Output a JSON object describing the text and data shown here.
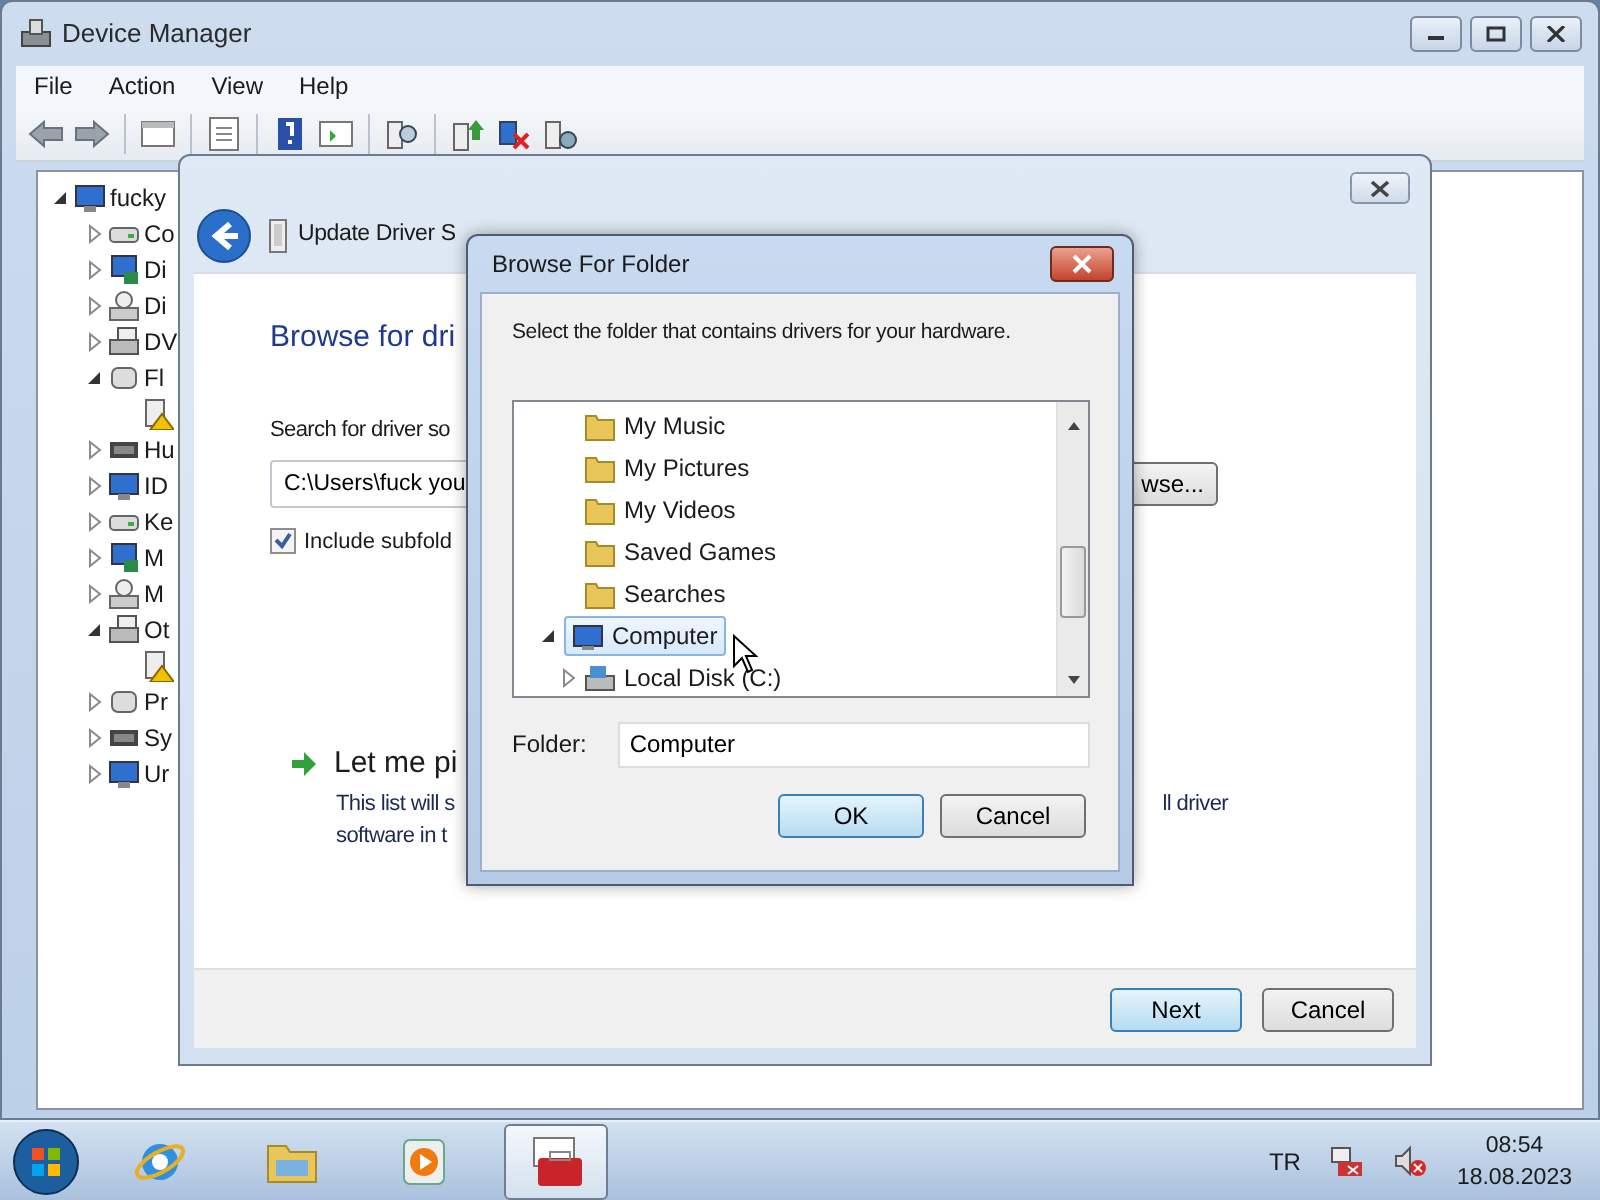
{
  "device_manager": {
    "title": "Device Manager",
    "menu": [
      "File",
      "Action",
      "View",
      "Help"
    ],
    "tree": [
      {
        "label": "fucky",
        "kind": "category",
        "expanded": true,
        "children": [
          {
            "label": "Co",
            "kind": "category",
            "expanded": false
          },
          {
            "label": "Di",
            "kind": "category",
            "expanded": false
          },
          {
            "label": "Di",
            "kind": "category",
            "expanded": false
          },
          {
            "label": "DV",
            "kind": "category",
            "expanded": false
          },
          {
            "label": "Fl",
            "kind": "category",
            "expanded": true,
            "children": [
              {
                "kind": "warning_device"
              }
            ]
          },
          {
            "label": "Hu",
            "kind": "category",
            "expanded": false
          },
          {
            "label": "ID",
            "kind": "category",
            "expanded": false
          },
          {
            "label": "Ke",
            "kind": "category",
            "expanded": false
          },
          {
            "label": "M",
            "kind": "category",
            "expanded": false
          },
          {
            "label": "M",
            "kind": "category",
            "expanded": false
          },
          {
            "label": "Ot",
            "kind": "category",
            "expanded": true,
            "children": [
              {
                "kind": "warning_device"
              }
            ]
          },
          {
            "label": "Pr",
            "kind": "category",
            "expanded": false
          },
          {
            "label": "Sy",
            "kind": "category",
            "expanded": false
          },
          {
            "label": "Ur",
            "kind": "category",
            "expanded": false
          }
        ]
      }
    ]
  },
  "wizard": {
    "header": "Update Driver S",
    "heading": "Browse for dri",
    "search_label": "Search for driver so",
    "path_value": "C:\\Users\\fuck you",
    "browse_button": "wse...",
    "include_subfolders": {
      "label": "Include subfold",
      "checked": true
    },
    "pick": {
      "title": "Let me pi",
      "line1": "This list will s",
      "line1_right": "ll driver",
      "line2": "software in t"
    },
    "buttons": [
      {
        "label": "Next",
        "default": true
      },
      {
        "label": "Cancel",
        "default": false
      }
    ]
  },
  "browse_dialog": {
    "title": "Browse For Folder",
    "prompt": "Select the folder that contains drivers for your hardware.",
    "tree": [
      {
        "children": [
          {
            "label": "My Music",
            "selected": false
          },
          {
            "label": "My Pictures",
            "selected": false
          },
          {
            "label": "My Videos",
            "selected": false
          },
          {
            "label": "Saved Games",
            "selected": false
          },
          {
            "label": "Searches",
            "selected": false
          }
        ]
      },
      {
        "label": "Computer",
        "selected": true,
        "expanded": true,
        "children": [
          {
            "label": "Local Disk (C:)",
            "selected": false,
            "expanded": false
          }
        ]
      }
    ],
    "folder_label": "Folder:",
    "folder_value": "Computer",
    "buttons": [
      {
        "label": "OK",
        "default": true
      },
      {
        "label": "Cancel",
        "default": false
      }
    ]
  },
  "taskbar": {
    "buttons": [
      {
        "kind": "browser",
        "active": false
      },
      {
        "kind": "explorer",
        "active": false
      },
      {
        "kind": "media",
        "active": false
      },
      {
        "kind": "toolbox",
        "active": true
      }
    ],
    "language": "TR",
    "time": "08:54",
    "date": "18.08.2023"
  }
}
